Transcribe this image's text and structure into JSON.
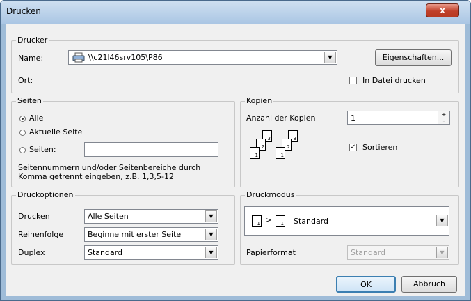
{
  "window": {
    "title": "Drucken",
    "close_symbol": "x"
  },
  "printer": {
    "group_label": "Drucker",
    "name_label": "Name:",
    "name_value": "\\\\c21l46srv105\\P86",
    "properties_button": "Eigenschaften...",
    "location_label": "Ort:",
    "print_to_file_label": "In Datei drucken",
    "print_to_file_checked": false
  },
  "pages": {
    "group_label": "Seiten",
    "option_all": "Alle",
    "option_current": "Aktuelle Seite",
    "option_pages": "Seiten:",
    "pages_input_value": "",
    "hint_line1": "Seitennummern und/oder Seitenbereiche durch",
    "hint_line2": "Komma getrennt eingeben, z.B. 1,3,5-12",
    "selected": "Alle"
  },
  "copies": {
    "group_label": "Kopien",
    "count_label": "Anzahl der Kopien",
    "count_value": "1",
    "collate_label": "Sortieren",
    "collate_checked": true,
    "collate_check_glyph": "✓",
    "collate_pages": [
      "1",
      "2",
      "3",
      "1",
      "2",
      "3"
    ]
  },
  "print_options": {
    "group_label": "Druckoptionen",
    "print_label": "Drucken",
    "print_value": "Alle Seiten",
    "order_label": "Reihenfolge",
    "order_value": "Beginne mit erster Seite",
    "duplex_label": "Duplex",
    "duplex_value": "Standard"
  },
  "print_mode": {
    "group_label": "Druckmodus",
    "mode_value": "Standard",
    "mode_pages": [
      "1",
      "1"
    ],
    "mode_arrow": ">",
    "paper_label": "Papierformat",
    "paper_value": "Standard"
  },
  "buttons": {
    "ok": "OK",
    "cancel": "Abbruch"
  }
}
